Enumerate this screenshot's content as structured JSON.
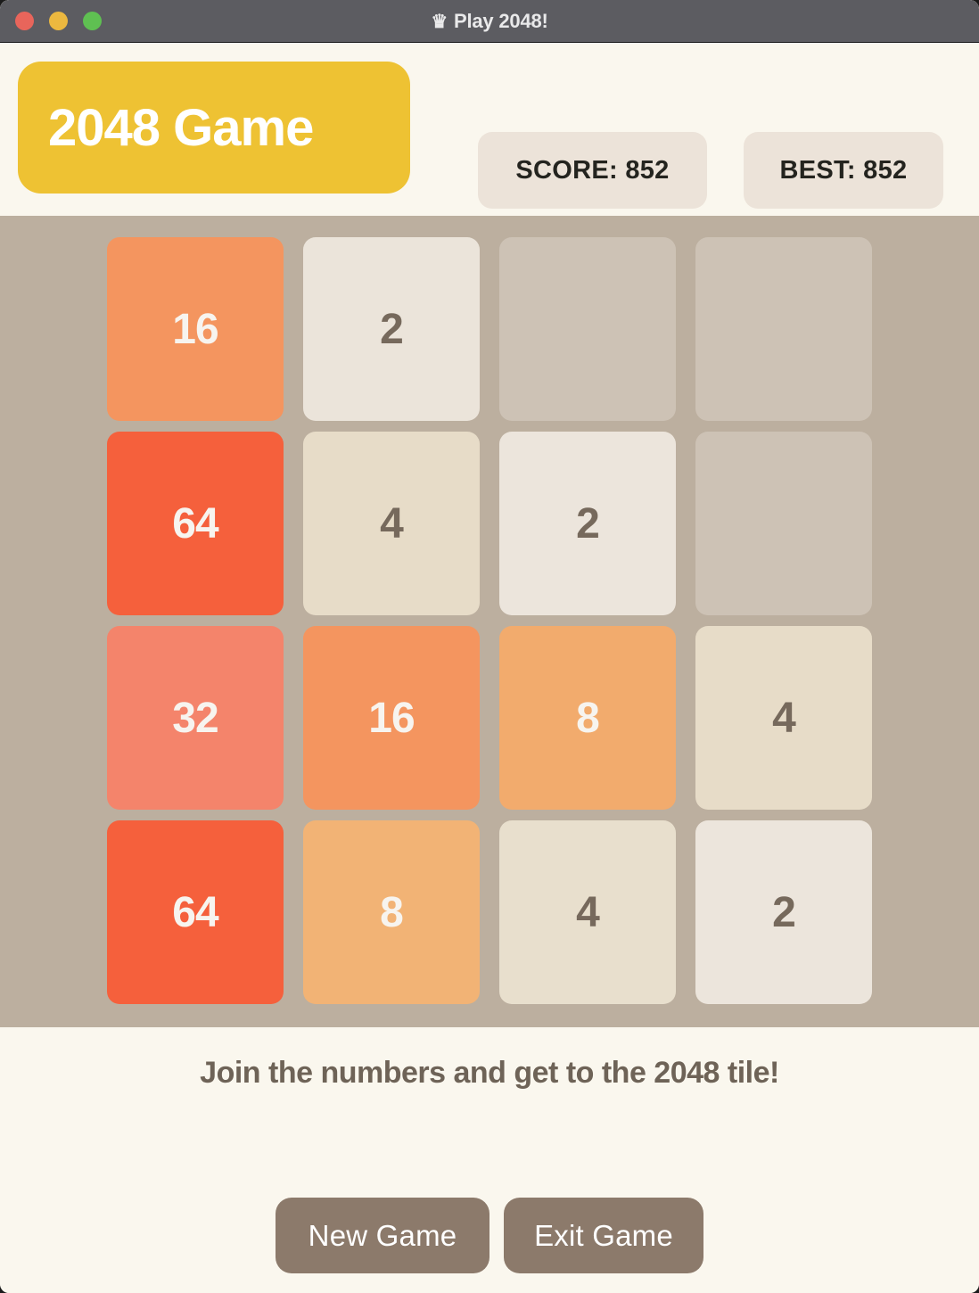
{
  "window": {
    "titlebar": {
      "crown_icon": "♛",
      "title": "Play 2048!",
      "traffic_lights": [
        {
          "name": "close",
          "color": "#e8655b"
        },
        {
          "name": "minimize",
          "color": "#ecb83f"
        },
        {
          "name": "maximize",
          "color": "#5fc052"
        }
      ]
    }
  },
  "header": {
    "brand": "2048 Game",
    "brand_color": "#eec233",
    "score_label": "SCORE: 852",
    "best_label": "BEST: 852",
    "score_value": 852,
    "best_value": 852,
    "pill_color": "#ece3d9"
  },
  "board": {
    "rows": 4,
    "cols": 4,
    "background": "#bcaf9f",
    "empty_color": "#cdc2b5",
    "cells": [
      [
        {
          "value": "16",
          "bg": "#f4955f",
          "fg": "#f7f4ef"
        },
        {
          "value": "2",
          "bg": "#ebe4da",
          "fg": "#76695c"
        },
        {
          "value": "",
          "bg": "#cdc2b5",
          "fg": "#76695c"
        },
        {
          "value": "",
          "bg": "#cdc2b5",
          "fg": "#76695c"
        }
      ],
      [
        {
          "value": "64",
          "bg": "#f5603c",
          "fg": "#f7f4ef"
        },
        {
          "value": "4",
          "bg": "#e7dcc8",
          "fg": "#76695c"
        },
        {
          "value": "2",
          "bg": "#ece5dc",
          "fg": "#76695c"
        },
        {
          "value": "",
          "bg": "#cdc2b5",
          "fg": "#76695c"
        }
      ],
      [
        {
          "value": "32",
          "bg": "#f4846b",
          "fg": "#f7f4ef"
        },
        {
          "value": "16",
          "bg": "#f4955f",
          "fg": "#f7f4ef"
        },
        {
          "value": "8",
          "bg": "#f2ab6d",
          "fg": "#f7f4ef"
        },
        {
          "value": "4",
          "bg": "#e7dcc8",
          "fg": "#76695c"
        }
      ],
      [
        {
          "value": "64",
          "bg": "#f5603c",
          "fg": "#f7f4ef"
        },
        {
          "value": "8",
          "bg": "#f2b375",
          "fg": "#f7f4ef"
        },
        {
          "value": "4",
          "bg": "#e8dfcd",
          "fg": "#76695c"
        },
        {
          "value": "2",
          "bg": "#ece5dc",
          "fg": "#76695c"
        }
      ]
    ]
  },
  "footer": {
    "tagline": "Join the numbers and get to the 2048 tile!",
    "new_game_label": "New Game",
    "exit_game_label": "Exit Game",
    "button_color": "#8c7a6b"
  }
}
